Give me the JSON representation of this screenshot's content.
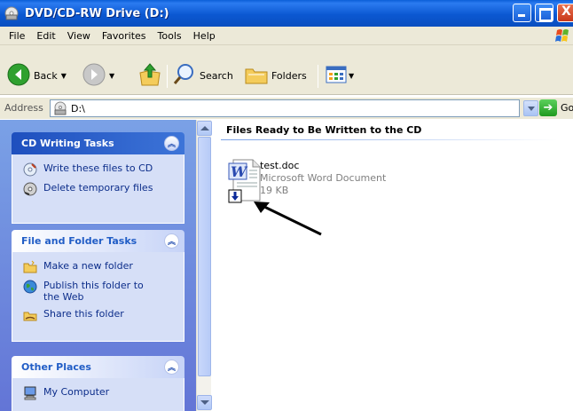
{
  "window": {
    "title": "DVD/CD-RW Drive (D:)"
  },
  "menu": {
    "items": [
      "File",
      "Edit",
      "View",
      "Favorites",
      "Tools",
      "Help"
    ]
  },
  "toolbar": {
    "back_label": "Back",
    "search_label": "Search",
    "folders_label": "Folders"
  },
  "address": {
    "label": "Address",
    "value": "D:\\",
    "go_label": "Go"
  },
  "taskpane": {
    "cd_tasks": {
      "title": "CD Writing Tasks",
      "items": [
        "Write these files to CD",
        "Delete temporary files"
      ]
    },
    "file_tasks": {
      "title": "File and Folder Tasks",
      "items": [
        "Make a new folder",
        "Publish this folder to the Web",
        "Share this folder"
      ]
    },
    "other_places": {
      "title": "Other Places",
      "items": [
        "My Computer"
      ]
    }
  },
  "content": {
    "group_heading": "Files Ready to Be Written to the CD",
    "file": {
      "name": "test.doc",
      "type": "Microsoft Word Document",
      "size": "19 KB"
    }
  }
}
